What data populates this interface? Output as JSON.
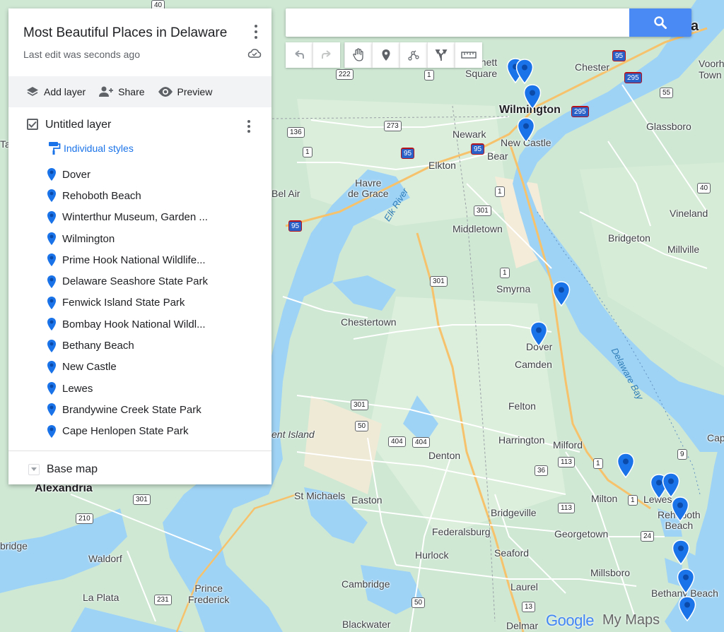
{
  "panel": {
    "title": "Most Beautiful Places in Delaware",
    "last_edit": "Last edit was seconds ago",
    "actions": {
      "add_layer": "Add layer",
      "share": "Share",
      "preview": "Preview"
    },
    "layer": {
      "name": "Untitled layer",
      "styles": "Individual styles",
      "places": [
        "Dover",
        "Rehoboth Beach",
        "Winterthur Museum, Garden ...",
        "Wilmington",
        "Prime Hook National Wildlife...",
        "Delaware Seashore State Park",
        "Fenwick Island State Park",
        "Bombay Hook National Wildl...",
        "Bethany Beach",
        "New Castle",
        "Lewes",
        "Brandywine Creek State Park",
        "Cape Henlopen State Park"
      ]
    },
    "base_map": "Base map"
  },
  "search": {
    "value": "",
    "placeholder": ""
  },
  "branding": {
    "google": "Google",
    "mymaps": "My Maps"
  },
  "colors": {
    "pin": "#1a73e8",
    "water": "#9fd3f5",
    "land": "#cfe8d4",
    "search_btn": "#4a8af4"
  },
  "map_labels": {
    "wilmington": "Wilmington",
    "new_castle": "New Castle",
    "newark": "Newark",
    "bear": "Bear",
    "elkton": "Elkton",
    "chester": "Chester",
    "glassboro": "Glassboro",
    "havre_de_grace": "Havre\nde Grace",
    "bel_air": "Bel Air",
    "middletown": "Middletown",
    "bridgeton": "Bridgeton",
    "vineland": "Vineland",
    "millville": "Millville",
    "smyrna": "Smyrna",
    "chestertown": "Chestertown",
    "dover": "Dover",
    "camden": "Camden",
    "felton": "Felton",
    "harrington": "Harrington",
    "milford": "Milford",
    "denton": "Denton",
    "st_michaels": "St Michaels",
    "easton": "Easton",
    "milton": "Milton",
    "lewes": "Lewes",
    "rehoboth": "Rehoboth\nBeach",
    "bridgeville": "Bridgeville",
    "federalsburg": "Federalsburg",
    "georgetown": "Georgetown",
    "hurlock": "Hurlock",
    "seaford": "Seaford",
    "millsboro": "Millsboro",
    "cambridge": "Cambridge",
    "laurel": "Laurel",
    "bethany": "Bethany Beach",
    "la_plata": "La Plata",
    "prince_frederick": "Prince\nFrederick",
    "waldorf": "Waldorf",
    "alexandria": "Alexandria",
    "bridge": "bridge",
    "blackwater": "Blackwater",
    "delmar": "Delmar",
    "kent_island": "ent Island",
    "square": "nnett\nSquare",
    "voorhees": "Voorh\nTown",
    "elk_river": "Elk River",
    "delaware_bay": "Delaware Bay",
    "cap": "Cap",
    "edge_a": "a",
    "edge_ta": "Ta"
  },
  "shields": {
    "s95a": "95",
    "s295a": "295",
    "s295b": "295",
    "s222": "222",
    "s1a": "1",
    "s136": "136",
    "s273": "273",
    "s1b": "1",
    "s95b": "95",
    "s95c": "95",
    "s40a": "40",
    "s55": "55",
    "s1c": "1",
    "s301a": "301",
    "s95d": "95",
    "s1d": "1",
    "s301b": "301",
    "s301c": "301",
    "s50a": "50",
    "s404a": "404",
    "s404b": "404",
    "s36": "36",
    "s113a": "113",
    "s1e": "1",
    "s9": "9",
    "s1f": "1",
    "s113b": "113",
    "s24": "24",
    "s50b": "50",
    "s231": "231",
    "s13": "13",
    "s301d": "301",
    "s210": "210",
    "s40b": "40"
  }
}
